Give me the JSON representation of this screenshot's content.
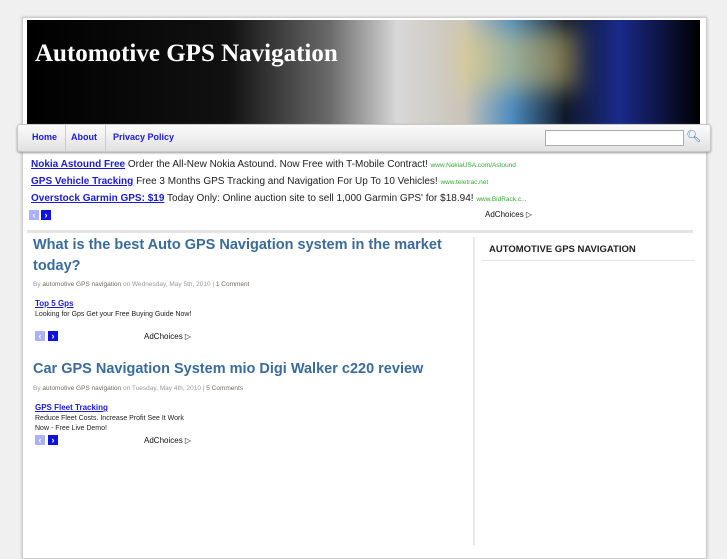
{
  "site": {
    "title": "Automotive GPS Navigation"
  },
  "nav": {
    "items": [
      "Home",
      "About",
      "Privacy Policy"
    ],
    "search_placeholder": "",
    "search_icon": "magnifier-icon"
  },
  "top_ads": [
    {
      "link": "Nokia Astound Free",
      "text": "Order the All-New Nokia Astound. Now Free with T-Mobile Contract!",
      "url": "www.NokiaUSA.com/Astound"
    },
    {
      "link": "GPS Vehicle Tracking",
      "text": "Free 3 Months GPS Tracking and Navigation For Up To 10 Vehicles!",
      "url": "www.teletrac.net"
    },
    {
      "link": "Overstock Garmin GPS: $19",
      "text": "Today Only: Online auction site to sell 1,000 Garmin GPS' for $18.94!",
      "url": "www.BidRack.c..."
    }
  ],
  "adchoices": "AdChoices",
  "posts": [
    {
      "title": "What is the best Auto GPS Navigation system in the market today?",
      "by": "By",
      "author": "automotive GPS navigation",
      "on": "on Wednesday, May 5th, 2010 |",
      "comments": "1 Comment",
      "ad_link": "Top 5 Gps",
      "ad_text": "Looking for Gps Get your Free Buying Guide Now!"
    },
    {
      "title": "Car GPS Navigation System mio Digi Walker c220 review",
      "by": "By",
      "author": "automotive GPS navigation",
      "on": "on Tuesday, May 4th, 2010 |",
      "comments": "5 Comments",
      "ad_link": "GPS Fleet Tracking",
      "ad_text": "Reduce Fleet Costs. Increase Profit See It Work Now - Free Live Demo!"
    }
  ],
  "sidebar": {
    "title": "AUTOMOTIVE GPS NAVIGATION"
  }
}
